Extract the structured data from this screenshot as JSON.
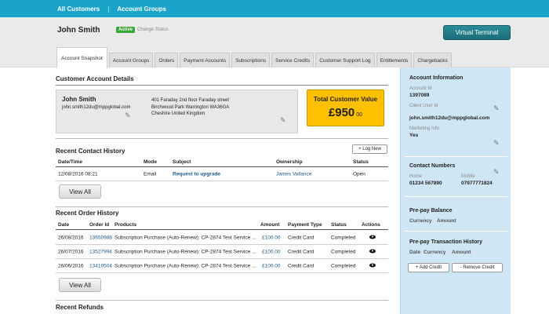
{
  "topnav": {
    "all_customers": "All Customers",
    "separator": "|",
    "account_groups": "Account Groups"
  },
  "header": {
    "customer_name": "John Smith",
    "status_badge": "Active",
    "change_status": "Change Status",
    "virtual_terminal": "Virtual Terminal"
  },
  "tabs": [
    {
      "label": "Account Snapshot",
      "active": true
    },
    {
      "label": "Account Groups"
    },
    {
      "label": "Orders"
    },
    {
      "label": "Payment Accounts"
    },
    {
      "label": "Subscriptions"
    },
    {
      "label": "Service Credits"
    },
    {
      "label": "Customer Support Log"
    },
    {
      "label": "Entitlements"
    },
    {
      "label": "Chargebacks"
    }
  ],
  "details": {
    "title": "Customer Account Details",
    "name": "John Smith",
    "email": "john.smith12du@mppglobal.com",
    "address": [
      "401 Faraday 2nd floor Faraday street",
      "Birchwood Park Warrington WA36GA",
      "Cheshire United Kingdom"
    ],
    "tcv_title": "Total Customer Value",
    "tcv_main": "£950",
    "tcv_pence": "00",
    "icons": {
      "edit": "pencil-icon"
    }
  },
  "contact_history": {
    "title": "Recent Contact History",
    "log_new": "+ Log New",
    "columns": [
      "Date/Time",
      "Mode",
      "Subject",
      "Ownership",
      "Status"
    ],
    "rows": [
      {
        "datetime": "12/08/2016 08:21",
        "mode": "Email",
        "subject": "Request to upgrade",
        "ownership": "James Vallance",
        "status": "Open"
      }
    ],
    "view_all": "View All"
  },
  "order_history": {
    "title": "Recent Order History",
    "columns": [
      "Date",
      "Order Id",
      "Products",
      "Amount",
      "Payment Type",
      "Status",
      "Actions"
    ],
    "rows": [
      {
        "date": "26/08/2016",
        "order_id": "13650988",
        "product": "Subscription Purchase (Auto-Renew): CP-2874 Test Service ...",
        "amount": "£100.00",
        "payment_type": "Credit Card",
        "status": "Completed"
      },
      {
        "date": "26/07/2016",
        "order_id": "13527994",
        "product": "Subscription Purchase (Auto-Renew): CP-2874 Test Service ...",
        "amount": "£100.00",
        "payment_type": "Credit Card",
        "status": "Completed"
      },
      {
        "date": "26/06/2016",
        "order_id": "13410504",
        "product": "Subscription Purchase (Auto-Renew): CP-2874 Test Service ...",
        "amount": "£100.00",
        "payment_type": "Credit Card",
        "status": "Completed"
      }
    ],
    "view_all": "View All",
    "action_icon": "eye-icon"
  },
  "refunds": {
    "title": "Recent Refunds"
  },
  "sidebar": {
    "account_info_title": "Account Information",
    "account_id_label": "Account Id",
    "account_id": "1397089",
    "client_user_id_label": "Client User Id",
    "email": "john.smith12du@mppglobal.com",
    "marketing_info_label": "Marketing Info",
    "marketing_info": "Yes",
    "contact_numbers_title": "Contact Numbers",
    "home_label": "Home",
    "home": "01234 567890",
    "mobile_label": "Mobile",
    "mobile": "07977771824",
    "prepay_balance_title": "Pre-pay Balance",
    "prepay_cols": [
      "Currency",
      "Amount"
    ],
    "prepay_tx_title": "Pre-pay Transaction History",
    "prepay_tx_cols": [
      "Date",
      "Currency",
      "Amount"
    ],
    "add_credit": "+ Add Credit",
    "remove_credit": "- Remove Credit"
  }
}
